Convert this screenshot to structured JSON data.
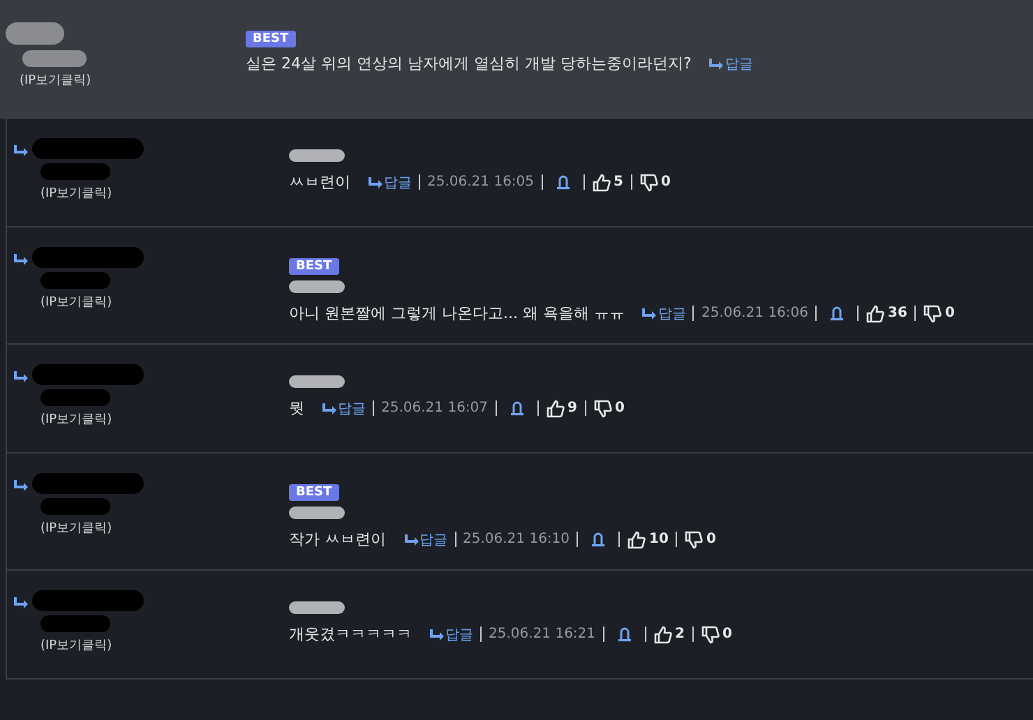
{
  "comments": [
    {
      "kind": "parent",
      "badge": "BEST",
      "ip_label": "(IP보기클릭)",
      "text": "실은 24살 위의 연상의 남자에게 열심히 개발 당하는중이라던지?",
      "reply_link": "답글"
    },
    {
      "kind": "reply",
      "ip_label": "(IP보기클릭)",
      "text": "ㅆㅂ련이",
      "reply_link": "답글",
      "date": "25.06.21 16:05",
      "likes": "5",
      "dislikes": "0"
    },
    {
      "kind": "reply",
      "badge": "BEST",
      "ip_label": "(IP보기클릭)",
      "text": "아니 원본짤에 그렇게 나온다고... 왜 욕을해 ㅠㅠ",
      "reply_link": "답글",
      "date": "25.06.21 16:06",
      "likes": "36",
      "dislikes": "0"
    },
    {
      "kind": "reply",
      "ip_label": "(IP보기클릭)",
      "text": "뭣",
      "reply_link": "답글",
      "date": "25.06.21 16:07",
      "likes": "9",
      "dislikes": "0"
    },
    {
      "kind": "reply",
      "badge": "BEST",
      "ip_label": "(IP보기클릭)",
      "text": "작가 ㅆㅂ련이",
      "reply_link": "답글",
      "date": "25.06.21 16:10",
      "likes": "10",
      "dislikes": "0"
    },
    {
      "kind": "reply",
      "ip_label": "(IP보기클릭)",
      "text": "개웃겼ㅋㅋㅋㅋㅋ",
      "reply_link": "답글",
      "date": "25.06.21 16:21",
      "likes": "2",
      "dislikes": "0"
    }
  ]
}
